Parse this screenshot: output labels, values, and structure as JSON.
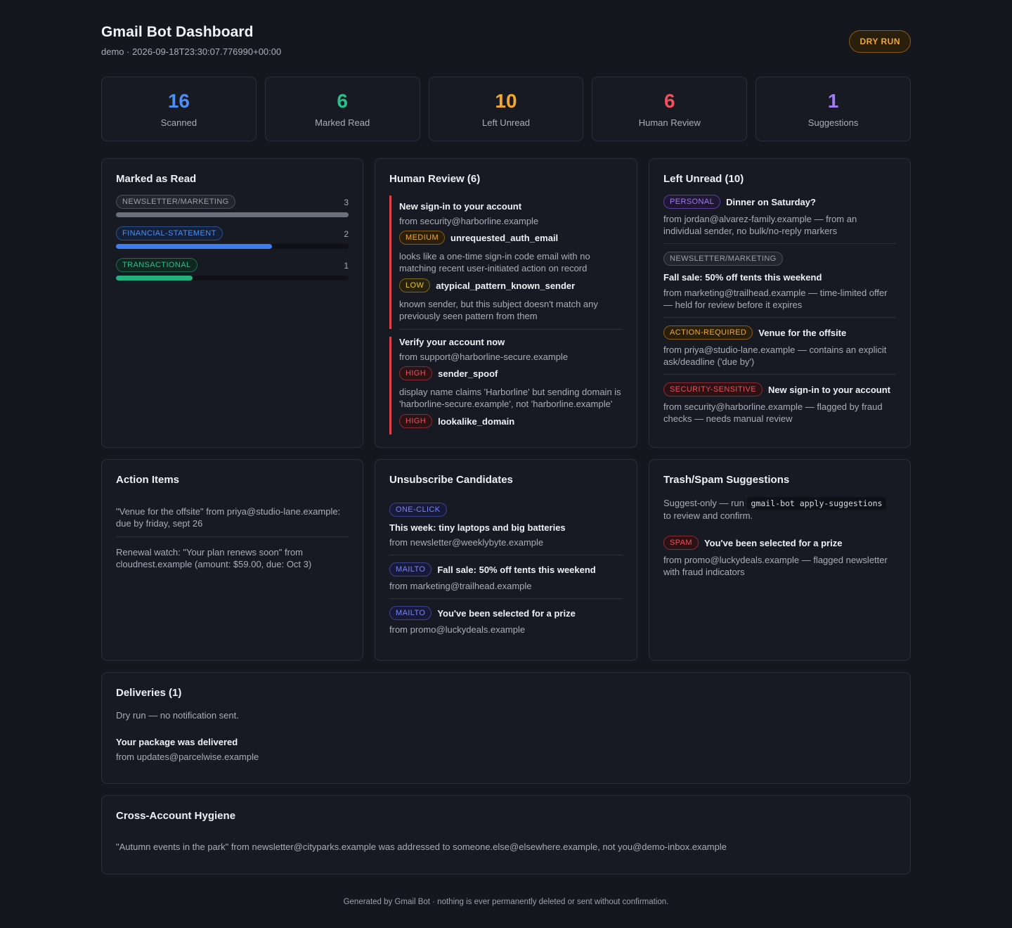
{
  "header": {
    "title": "Gmail Bot Dashboard",
    "subtitle": "demo · 2026-09-18T23:30:07.776990+00:00",
    "mode_badge": "DRY RUN"
  },
  "stats": [
    {
      "value": "16",
      "label": "Scanned",
      "color": "#4e8df5"
    },
    {
      "value": "6",
      "label": "Marked Read",
      "color": "#27c08a"
    },
    {
      "value": "10",
      "label": "Left Unread",
      "color": "#f0a830"
    },
    {
      "value": "6",
      "label": "Human Review",
      "color": "#f0515b"
    },
    {
      "value": "1",
      "label": "Suggestions",
      "color": "#a27bf5"
    }
  ],
  "marked_read": {
    "title": "Marked as Read",
    "rows": [
      {
        "label": "NEWSLETTER/MARKETING",
        "count": "3",
        "fraction": 1.0,
        "color": "#6b707d"
      },
      {
        "label": "FINANCIAL-STATEMENT",
        "count": "2",
        "fraction": 0.67,
        "color": "#3b7cf0"
      },
      {
        "label": "TRANSACTIONAL",
        "count": "1",
        "fraction": 0.33,
        "color": "#22b07c"
      }
    ]
  },
  "human_review": {
    "title": "Human Review (6)",
    "items": [
      {
        "subject": "New sign-in to your account",
        "from": "from security@harborline.example",
        "flags": [
          {
            "severity": "MEDIUM",
            "code": "unrequested_auth_email",
            "reason": "looks like a one-time sign-in code email with no matching recent user-initiated action on record"
          },
          {
            "severity": "LOW",
            "code": "atypical_pattern_known_sender",
            "reason": "known sender, but this subject doesn't match any previously seen pattern from them"
          }
        ]
      },
      {
        "subject": "Verify your account now",
        "from": "from support@harborline-secure.example",
        "flags": [
          {
            "severity": "HIGH",
            "code": "sender_spoof",
            "reason": "display name claims 'Harborline' but sending domain is 'harborline-secure.example', not 'harborline.example'"
          },
          {
            "severity": "HIGH",
            "code": "lookalike_domain",
            "reason": ""
          }
        ]
      }
    ]
  },
  "left_unread": {
    "title": "Left Unread (10)",
    "items": [
      {
        "tag": "PERSONAL",
        "subject": "Dinner on Saturday?",
        "detail": "from jordan@alvarez-family.example — from an individual sender, no bulk/no-reply markers"
      },
      {
        "tag": "NEWSLETTER/MARKETING",
        "subject": "Fall sale: 50% off tents this weekend",
        "detail": "from marketing@trailhead.example — time-limited offer — held for review before it expires"
      },
      {
        "tag": "ACTION-REQUIRED",
        "subject": "Venue for the offsite",
        "detail": "from priya@studio-lane.example — contains an explicit ask/deadline ('due by')"
      },
      {
        "tag": "SECURITY-SENSITIVE",
        "subject": "New sign-in to your account",
        "detail": "from security@harborline.example — flagged by fraud checks — needs manual review"
      }
    ]
  },
  "action_items": {
    "title": "Action Items",
    "items": [
      "\"Venue for the offsite\" from priya@studio-lane.example: due by friday, sept 26",
      "Renewal watch: \"Your plan renews soon\" from cloudnest.example (amount: $59.00, due: Oct 3)"
    ]
  },
  "unsubscribe": {
    "title": "Unsubscribe Candidates",
    "items": [
      {
        "method": "ONE-CLICK",
        "subject": "This week: tiny laptops and big batteries",
        "from": "from newsletter@weeklybyte.example"
      },
      {
        "method": "MAILTO",
        "subject": "Fall sale: 50% off tents this weekend",
        "from": "from marketing@trailhead.example"
      },
      {
        "method": "MAILTO",
        "subject": "You've been selected for a prize",
        "from": "from promo@luckydeals.example"
      }
    ]
  },
  "trash": {
    "title": "Trash/Spam Suggestions",
    "note_prefix": "Suggest-only — run",
    "command": "gmail-bot apply-suggestions",
    "note_suffix": "to review and confirm.",
    "items": [
      {
        "tag": "SPAM",
        "subject": "You've been selected for a prize",
        "detail": "from promo@luckydeals.example — flagged newsletter with fraud indicators"
      }
    ]
  },
  "deliveries": {
    "title": "Deliveries (1)",
    "note": "Dry run — no notification sent.",
    "subject": "Your package was delivered",
    "from": "from updates@parcelwise.example"
  },
  "hygiene": {
    "title": "Cross-Account Hygiene",
    "text": "\"Autumn events in the park\" from newsletter@cityparks.example was addressed to someone.else@elsewhere.example, not you@demo-inbox.example"
  },
  "footer": "Generated by Gmail Bot · nothing is ever permanently deleted or sent without confirmation."
}
